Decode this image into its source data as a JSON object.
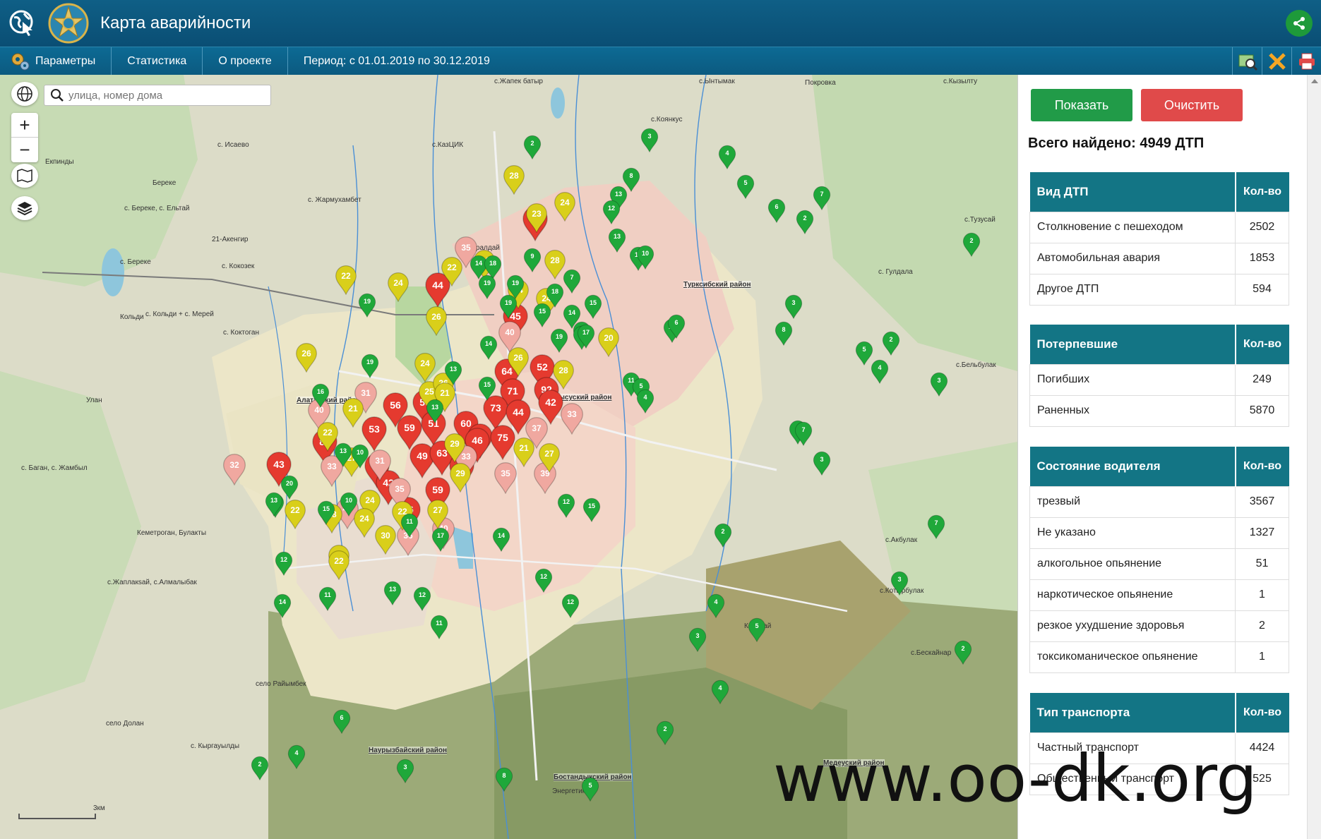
{
  "header": {
    "title": "Карта аварийности"
  },
  "menu": {
    "params": "Параметры",
    "stats": "Статистика",
    "about": "О проекте",
    "period": "Период: с 01.01.2019 по 30.12.2019"
  },
  "map": {
    "search_placeholder": "улица, номер дома",
    "zoom_in": "+",
    "zoom_out": "−",
    "scale_label": "3км",
    "places": [
      "с.Жапек батыр",
      "с.Ынтымак",
      "Покровка",
      "с.Кызылту",
      "с. Исаево",
      "с.Коянкус",
      "Екпинды",
      "Береке",
      "с.КазЦИК",
      "с. Береке, с. Ельтай",
      "с. Жармухамбет",
      "21-Акенгир",
      "с. Береке",
      "с. Кокозек",
      "с.Боралдай",
      "с.Тузусай",
      "с. Гулдала",
      "Кольди",
      "с. Кольди + с. Мерей",
      "с. Коктоган",
      "Улан",
      "с.Бельбулак",
      "с. Баган, с. Жамбыл",
      "Кеметроган, Булакты",
      "с.Акбулак",
      "с.Жаплакsай, с.Алмалыбак",
      "с.Котырбулак",
      "Кольсай",
      "с.Бескайнар",
      "село Райымбек",
      "село Долан",
      "с. Кыргауылды",
      "Алатауский район",
      "Турксибский район",
      "Жетысуский район",
      "Наурызбайский район",
      "Бостандыкский район",
      "Медеуский район",
      "Энергетик"
    ],
    "markers": [
      {
        "n": "44",
        "c": "red"
      },
      {
        "n": "54",
        "c": "red"
      },
      {
        "n": "45",
        "c": "red"
      },
      {
        "n": "52",
        "c": "red"
      },
      {
        "n": "64",
        "c": "red"
      },
      {
        "n": "71",
        "c": "red"
      },
      {
        "n": "92",
        "c": "red"
      },
      {
        "n": "56",
        "c": "red"
      },
      {
        "n": "55",
        "c": "red"
      },
      {
        "n": "73",
        "c": "red"
      },
      {
        "n": "44",
        "c": "red"
      },
      {
        "n": "42",
        "c": "red"
      },
      {
        "n": "53",
        "c": "red"
      },
      {
        "n": "59",
        "c": "red"
      },
      {
        "n": "51",
        "c": "red"
      },
      {
        "n": "60",
        "c": "red"
      },
      {
        "n": "45",
        "c": "red"
      },
      {
        "n": "81",
        "c": "red"
      },
      {
        "n": "46",
        "c": "red"
      },
      {
        "n": "75",
        "c": "red"
      },
      {
        "n": "49",
        "c": "red"
      },
      {
        "n": "63",
        "c": "red"
      },
      {
        "n": "43",
        "c": "red"
      },
      {
        "n": "45",
        "c": "red"
      },
      {
        "n": "47",
        "c": "red"
      },
      {
        "n": "42",
        "c": "red"
      },
      {
        "n": "59",
        "c": "red"
      },
      {
        "n": "56",
        "c": "red"
      },
      {
        "n": "35",
        "c": "pink"
      },
      {
        "n": "40",
        "c": "pink"
      },
      {
        "n": "31",
        "c": "pink"
      },
      {
        "n": "33",
        "c": "pink"
      },
      {
        "n": "31",
        "c": "pink"
      },
      {
        "n": "33",
        "c": "pink"
      },
      {
        "n": "40",
        "c": "pink"
      },
      {
        "n": "37",
        "c": "pink"
      },
      {
        "n": "32",
        "c": "pink"
      },
      {
        "n": "33",
        "c": "pink"
      },
      {
        "n": "35",
        "c": "pink"
      },
      {
        "n": "40",
        "c": "pink"
      },
      {
        "n": "35",
        "c": "pink"
      },
      {
        "n": "39",
        "c": "pink"
      },
      {
        "n": "36",
        "c": "pink"
      },
      {
        "n": "40",
        "c": "pink"
      },
      {
        "n": "28",
        "c": "yellow"
      },
      {
        "n": "23",
        "c": "yellow"
      },
      {
        "n": "24",
        "c": "yellow"
      },
      {
        "n": "22",
        "c": "yellow"
      },
      {
        "n": "22",
        "c": "yellow"
      },
      {
        "n": "24",
        "c": "yellow"
      },
      {
        "n": "24",
        "c": "yellow"
      },
      {
        "n": "26",
        "c": "yellow"
      },
      {
        "n": "28",
        "c": "yellow"
      },
      {
        "n": "26",
        "c": "yellow"
      },
      {
        "n": "24",
        "c": "yellow"
      },
      {
        "n": "24",
        "c": "yellow"
      },
      {
        "n": "26",
        "c": "yellow"
      },
      {
        "n": "24",
        "c": "yellow"
      },
      {
        "n": "25",
        "c": "yellow"
      },
      {
        "n": "21",
        "c": "yellow"
      },
      {
        "n": "26",
        "c": "yellow"
      },
      {
        "n": "20",
        "c": "yellow"
      },
      {
        "n": "21",
        "c": "yellow"
      },
      {
        "n": "28",
        "c": "yellow"
      },
      {
        "n": "29",
        "c": "yellow"
      },
      {
        "n": "22",
        "c": "yellow"
      },
      {
        "n": "27",
        "c": "yellow"
      },
      {
        "n": "21",
        "c": "yellow"
      },
      {
        "n": "27",
        "c": "yellow"
      },
      {
        "n": "24",
        "c": "yellow"
      },
      {
        "n": "28",
        "c": "yellow"
      },
      {
        "n": "24",
        "c": "yellow"
      },
      {
        "n": "22",
        "c": "yellow"
      },
      {
        "n": "27",
        "c": "yellow"
      },
      {
        "n": "30",
        "c": "yellow"
      },
      {
        "n": "29",
        "c": "yellow"
      },
      {
        "n": "24",
        "c": "yellow"
      },
      {
        "n": "22",
        "c": "yellow"
      },
      {
        "n": "22",
        "c": "yellow"
      },
      {
        "n": "14",
        "c": "green"
      },
      {
        "n": "18",
        "c": "green"
      },
      {
        "n": "19",
        "c": "green"
      },
      {
        "n": "19",
        "c": "green"
      },
      {
        "n": "19",
        "c": "green"
      },
      {
        "n": "18",
        "c": "green"
      },
      {
        "n": "13",
        "c": "green"
      },
      {
        "n": "12",
        "c": "green"
      },
      {
        "n": "13",
        "c": "green"
      },
      {
        "n": "16",
        "c": "green"
      },
      {
        "n": "14",
        "c": "green"
      },
      {
        "n": "15",
        "c": "green"
      },
      {
        "n": "19",
        "c": "green"
      },
      {
        "n": "12",
        "c": "green"
      },
      {
        "n": "15",
        "c": "green"
      },
      {
        "n": "17",
        "c": "green"
      },
      {
        "n": "19",
        "c": "green"
      },
      {
        "n": "13",
        "c": "green"
      },
      {
        "n": "14",
        "c": "green"
      },
      {
        "n": "11",
        "c": "green"
      },
      {
        "n": "16",
        "c": "green"
      },
      {
        "n": "19",
        "c": "green"
      },
      {
        "n": "10",
        "c": "green"
      },
      {
        "n": "17",
        "c": "green"
      },
      {
        "n": "15",
        "c": "green"
      },
      {
        "n": "13",
        "c": "green"
      },
      {
        "n": "20",
        "c": "green"
      },
      {
        "n": "11",
        "c": "green"
      },
      {
        "n": "12",
        "c": "green"
      },
      {
        "n": "13",
        "c": "green"
      },
      {
        "n": "12",
        "c": "green"
      },
      {
        "n": "15",
        "c": "green"
      },
      {
        "n": "14",
        "c": "green"
      },
      {
        "n": "12",
        "c": "green"
      },
      {
        "n": "17",
        "c": "green"
      },
      {
        "n": "15",
        "c": "green"
      },
      {
        "n": "11",
        "c": "green"
      },
      {
        "n": "11",
        "c": "green"
      },
      {
        "n": "12",
        "c": "green"
      },
      {
        "n": "11",
        "c": "green"
      },
      {
        "n": "13",
        "c": "green"
      },
      {
        "n": "12",
        "c": "green"
      },
      {
        "n": "10",
        "c": "green"
      },
      {
        "n": "14",
        "c": "green"
      },
      {
        "n": "15",
        "c": "green"
      },
      {
        "n": "13",
        "c": "green"
      },
      {
        "n": "9",
        "c": "green"
      },
      {
        "n": "10",
        "c": "green"
      },
      {
        "n": "6",
        "c": "green"
      },
      {
        "n": "5",
        "c": "green"
      },
      {
        "n": "4",
        "c": "green"
      },
      {
        "n": "8",
        "c": "green"
      },
      {
        "n": "7",
        "c": "green"
      },
      {
        "n": "2",
        "c": "green"
      },
      {
        "n": "3",
        "c": "green"
      },
      {
        "n": "4",
        "c": "green"
      },
      {
        "n": "5",
        "c": "green"
      },
      {
        "n": "6",
        "c": "green"
      },
      {
        "n": "7",
        "c": "green"
      },
      {
        "n": "8",
        "c": "green"
      },
      {
        "n": "2",
        "c": "green"
      },
      {
        "n": "3",
        "c": "green"
      },
      {
        "n": "2",
        "c": "green"
      },
      {
        "n": "5",
        "c": "green"
      },
      {
        "n": "4",
        "c": "green"
      },
      {
        "n": "3",
        "c": "green"
      },
      {
        "n": "2",
        "c": "green"
      },
      {
        "n": "6",
        "c": "green"
      },
      {
        "n": "7",
        "c": "green"
      },
      {
        "n": "3",
        "c": "green"
      },
      {
        "n": "2",
        "c": "green"
      },
      {
        "n": "4",
        "c": "green"
      },
      {
        "n": "5",
        "c": "green"
      },
      {
        "n": "3",
        "c": "green"
      },
      {
        "n": "2",
        "c": "green"
      },
      {
        "n": "7",
        "c": "green"
      },
      {
        "n": "3",
        "c": "green"
      },
      {
        "n": "4",
        "c": "green"
      },
      {
        "n": "2",
        "c": "green"
      },
      {
        "n": "5",
        "c": "green"
      },
      {
        "n": "8",
        "c": "green"
      },
      {
        "n": "3",
        "c": "green"
      },
      {
        "n": "6",
        "c": "green"
      },
      {
        "n": "4",
        "c": "green"
      },
      {
        "n": "2",
        "c": "green"
      }
    ]
  },
  "panel": {
    "show_btn": "Показать",
    "clear_btn": "Очистить",
    "total": "Всего найдено: 4949 ДТП",
    "tables": [
      {
        "header": "Вид ДТП",
        "count_header": "Кол-во",
        "rows": [
          {
            "label": "Столкновение с пешеходом",
            "value": "2502"
          },
          {
            "label": "Автомобильная авария",
            "value": "1853"
          },
          {
            "label": "Другое ДТП",
            "value": "594"
          }
        ]
      },
      {
        "header": "Потерпевшие",
        "count_header": "Кол-во",
        "rows": [
          {
            "label": "Погибших",
            "value": "249"
          },
          {
            "label": "Раненных",
            "value": "5870"
          }
        ]
      },
      {
        "header": "Состояние водителя",
        "count_header": "Кол-во",
        "rows": [
          {
            "label": "трезвый",
            "value": "3567"
          },
          {
            "label": "Не указано",
            "value": "1327"
          },
          {
            "label": "алкогольное опьянение",
            "value": "51"
          },
          {
            "label": "наркотическое опьянение",
            "value": "1"
          },
          {
            "label": "резкое ухудшение здоровья",
            "value": "2"
          },
          {
            "label": "токсикоманическое опьянение",
            "value": "1"
          }
        ]
      },
      {
        "header": "Тип транспорта",
        "count_header": "Кол-во",
        "rows": [
          {
            "label": "Частный транспорт",
            "value": "4424"
          },
          {
            "label": "Общественный транспорт",
            "value": "525"
          }
        ]
      }
    ]
  },
  "watermark": "www.oo-dk.org",
  "colors": {
    "header": "#0a4e74",
    "table_header": "#137585",
    "show": "#219b48",
    "clear": "#e04a4a",
    "marker_red": "#e53a2f",
    "marker_pink": "#f0a8a0",
    "marker_yellow": "#d9cf1a",
    "marker_green": "#1fa83a"
  }
}
